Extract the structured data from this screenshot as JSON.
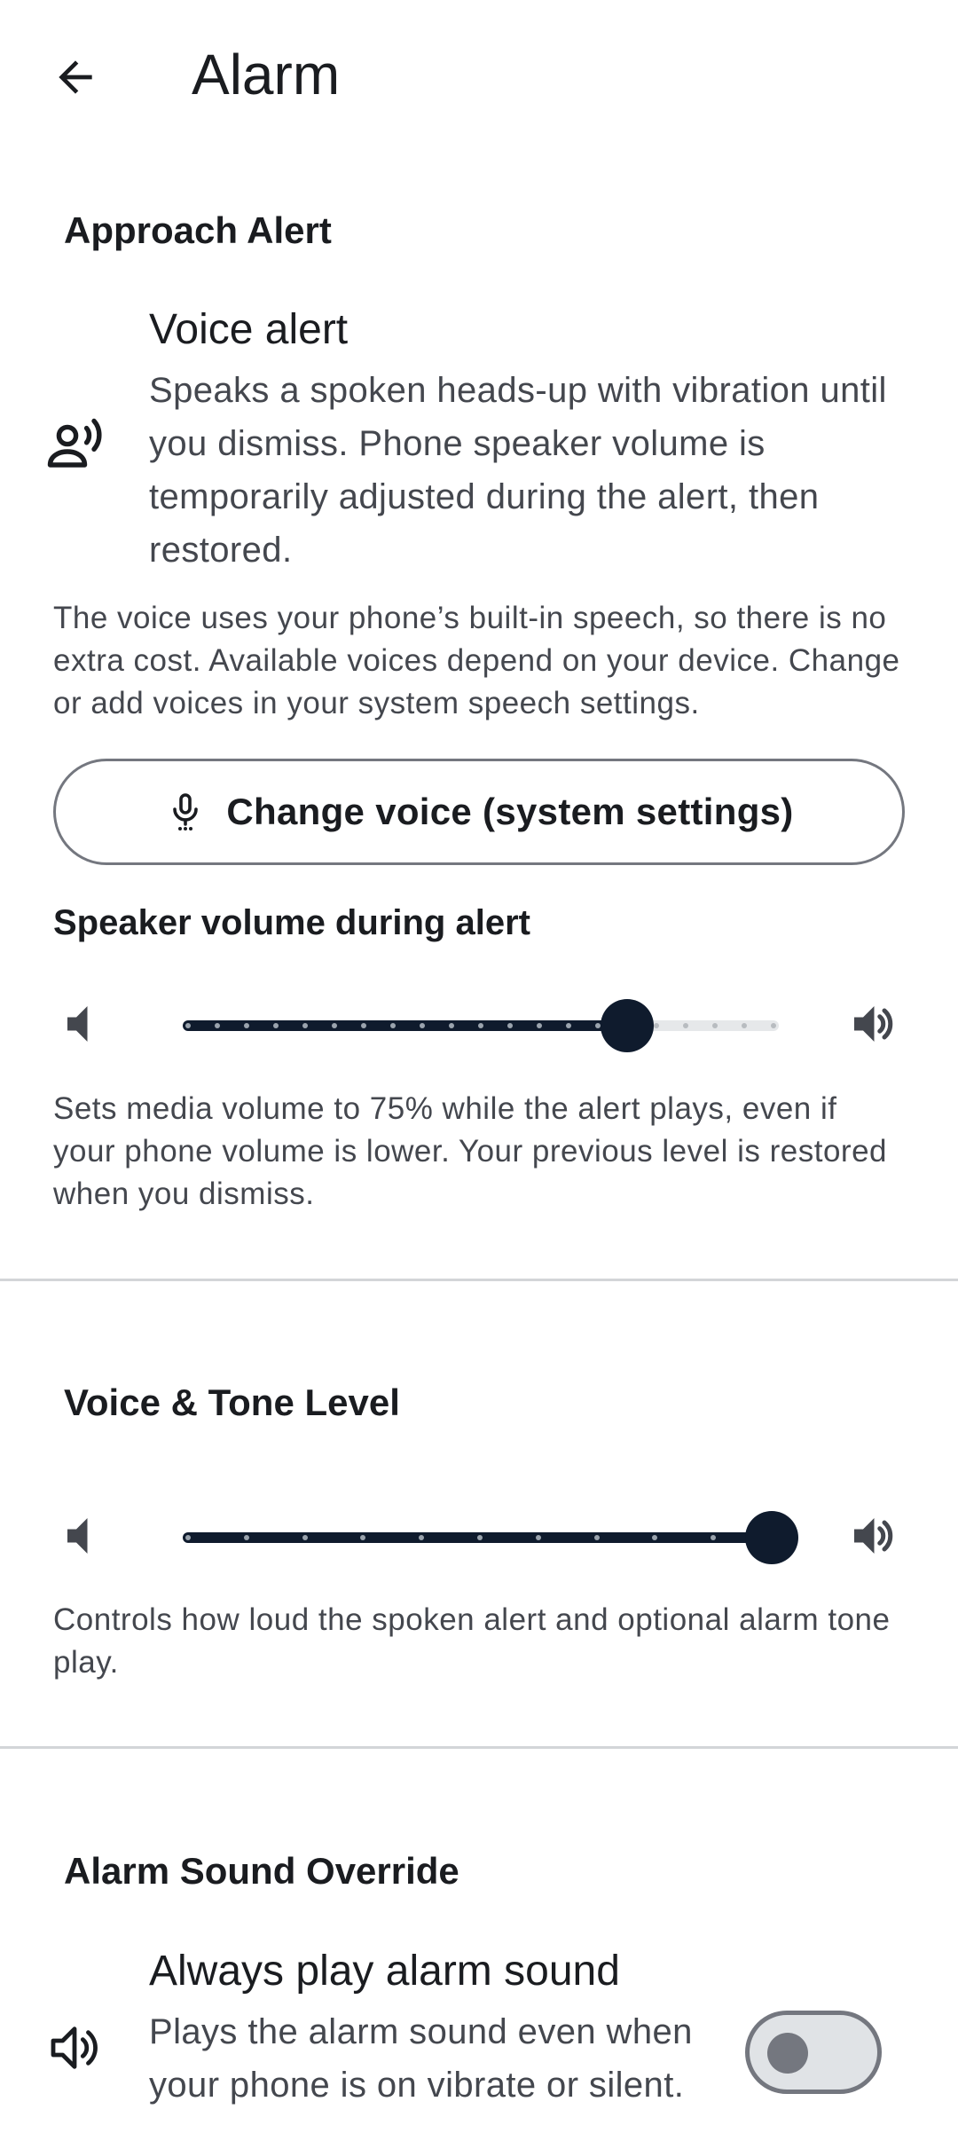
{
  "app_bar": {
    "title": "Alarm",
    "back_icon": "arrow-back-icon"
  },
  "approach_alert": {
    "header": "Approach Alert",
    "voice_alert": {
      "icon": "record-voice-icon",
      "title": "Voice alert",
      "summary": "Speaks a spoken heads-up with vibration until you dismiss. Phone speaker volume is temporarily adjusted during the alert, then restored."
    },
    "voice_info": "The voice uses your phone’s built-in speech, so there is no extra cost. Available voices depend on your device. Change or add voices in your system speech settings.",
    "change_voice_button": {
      "label": "Change voice (system settings)",
      "icon": "mic-icon"
    },
    "speaker_volume": {
      "label": "Speaker volume during alert",
      "value_fraction": 0.75,
      "steps": 20,
      "low_icon": "volume-low-icon",
      "high_icon": "volume-high-icon",
      "description": "Sets media volume to 75% while the alert plays, even if your phone volume is lower. Your previous level is restored when you dismiss."
    }
  },
  "voice_tone": {
    "header": "Voice & Tone Level",
    "value_fraction": 1.0,
    "steps": 10,
    "low_icon": "volume-low-icon",
    "high_icon": "volume-high-icon",
    "description": "Controls how loud the spoken alert and optional alarm tone play."
  },
  "alarm_override": {
    "header": "Alarm Sound Override",
    "always_play": {
      "icon": "volume-up-icon",
      "title": "Always play alarm sound",
      "summary": "Plays the alarm sound even when your phone is on vibrate or silent.",
      "enabled": false
    }
  },
  "colors": {
    "accent": "#0f1b2d",
    "inactive_track": "#e6e8ea",
    "text_primary": "#1a1c20",
    "text_secondary": "#44474e",
    "outline": "#74777f",
    "divider": "#d3d5d8"
  }
}
